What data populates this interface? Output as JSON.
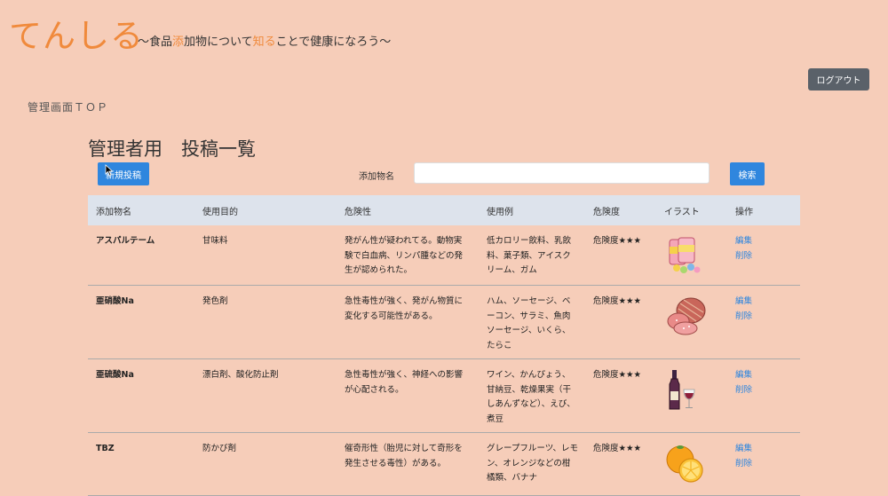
{
  "header": {
    "logo": "てんしる",
    "tagline_parts": [
      "〜食品",
      "添",
      "加物について",
      "知る",
      "ことで健康になろう〜"
    ],
    "logout_label": "ログアウト"
  },
  "nav": {
    "top_link": "管理画面ＴＯＰ"
  },
  "page": {
    "title": "管理者用　投稿一覧",
    "new_post_label": "新規投稿",
    "search_label": "添加物名",
    "search_value": "",
    "search_button_label": "検索"
  },
  "table": {
    "headers": [
      "添加物名",
      "使用目的",
      "危険性",
      "使用例",
      "危険度",
      "イラスト",
      "操作"
    ],
    "rows": [
      {
        "name": "アスパルテーム",
        "purpose": "甘味料",
        "risk": "発がん性が疑われてる。動物実験で白血病、リンパ腫などの発生が認められた。",
        "examples": "低カロリー飲料、乳飲料、菓子類、アイスクリーム、ガム",
        "danger": "危険度★★★",
        "illustration": "sweets-illustration",
        "edit": "編集",
        "delete": "削除"
      },
      {
        "name": "亜硝酸Na",
        "purpose": "発色剤",
        "risk": "急性毒性が強く、発がん物質に変化する可能性がある。",
        "examples": "ハム、ソーセージ、ベーコン、サラミ、魚肉ソーセージ、いくら、たらこ",
        "danger": "危険度★★★",
        "illustration": "ham-illustration",
        "edit": "編集",
        "delete": "削除"
      },
      {
        "name": "亜硫酸Na",
        "purpose": "漂白剤、酸化防止剤",
        "risk": "急性毒性が強く、神経への影響が心配される。",
        "examples": "ワイン、かんぴょう、甘納豆、乾燥果実（干しあんずなど）、えび、煮豆",
        "danger": "危険度★★★",
        "illustration": "wine-illustration",
        "edit": "編集",
        "delete": "削除"
      },
      {
        "name": "TBZ",
        "purpose": "防かび剤",
        "risk": "催奇形性（胎児に対して奇形を発生させる毒性）がある。",
        "examples": "グレープフルーツ、レモン、オレンジなどの柑橘類、バナナ",
        "danger": "危険度★★★",
        "illustration": "orange-illustration",
        "edit": "編集",
        "delete": "削除"
      }
    ]
  },
  "colors": {
    "background": "#f6cdb9",
    "brand": "#f08a3c",
    "primary_button": "#2f86de",
    "logout_button": "#5a6169",
    "table_header": "#dde3ec"
  }
}
